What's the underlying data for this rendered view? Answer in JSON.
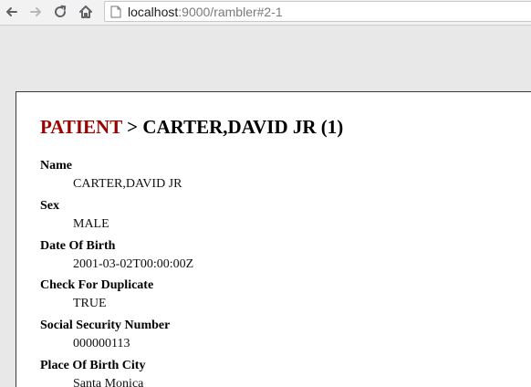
{
  "browser": {
    "url_host": "localhost",
    "url_path": ":9000/rambler#2-1",
    "nav_icons": [
      "back-arrow-icon",
      "forward-arrow-icon",
      "reload-icon",
      "home-icon",
      "page-icon"
    ]
  },
  "page": {
    "title_category": "PATIENT",
    "title_separator": " > ",
    "title_subject": "CARTER,DAVID JR (1)",
    "accent_color": "#990000",
    "fields": [
      {
        "label": "Name",
        "value": "CARTER,DAVID JR"
      },
      {
        "label": "Sex",
        "value": "MALE"
      },
      {
        "label": "Date Of Birth",
        "value": "2001-03-02T00:00:00Z"
      },
      {
        "label": "Check For Duplicate",
        "value": "TRUE"
      },
      {
        "label": "Social Security Number",
        "value": "000000113"
      },
      {
        "label": "Place Of Birth City",
        "value": "Santa Monica"
      }
    ]
  }
}
